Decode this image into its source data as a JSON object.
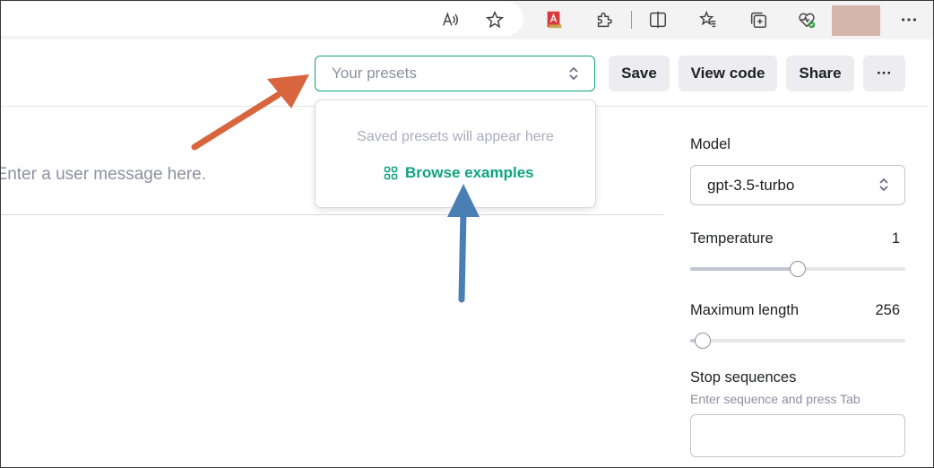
{
  "header": {
    "presets_placeholder": "Your presets",
    "save_label": "Save",
    "view_code_label": "View code",
    "share_label": "Share",
    "more_label": "···"
  },
  "presets_dropdown": {
    "empty_text": "Saved presets will appear here",
    "browse_label": "Browse examples"
  },
  "main": {
    "user_message_placeholder": "Enter a user message here."
  },
  "panel": {
    "model_label": "Model",
    "model_value": "gpt-3.5-turbo",
    "temperature_label": "Temperature",
    "temperature_value": "1",
    "temperature_fraction": 0.5,
    "max_length_label": "Maximum length",
    "max_length_value": "256",
    "max_length_fraction": 0.06,
    "stop_label": "Stop sequences",
    "stop_hint": "Enter sequence and press Tab"
  },
  "browser_icons": [
    "read-aloud-icon",
    "favorite-star-icon",
    "pdf-extension-icon",
    "extensions-icon",
    "split-screen-icon",
    "favorites-icon",
    "collections-icon",
    "browser-essentials-icon",
    "profile-avatar",
    "more-options-icon"
  ],
  "colors": {
    "accent_green": "#10a37f",
    "annotation_orange": "#d9653f",
    "annotation_blue": "#4a7fb5"
  }
}
